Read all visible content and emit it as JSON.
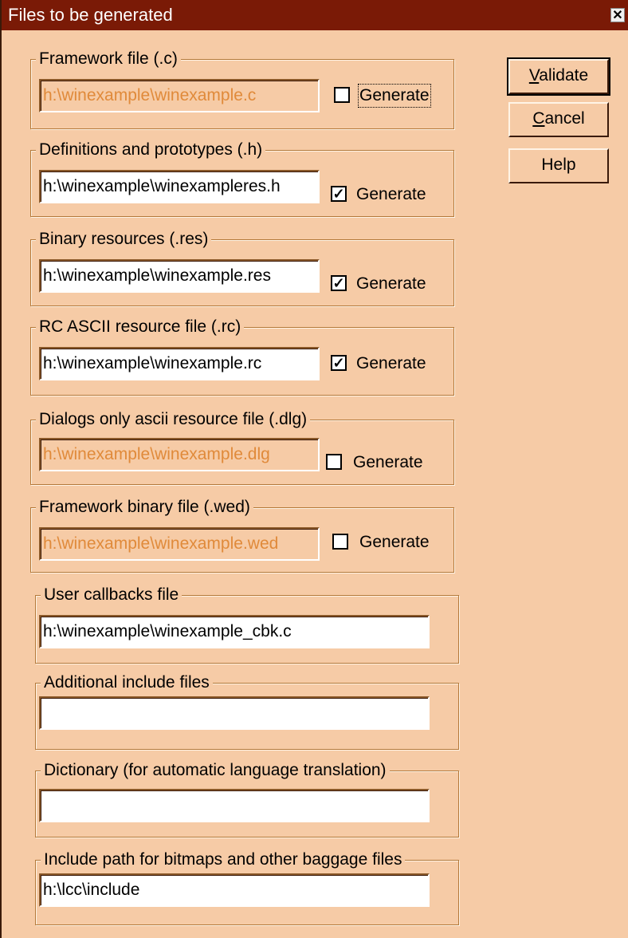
{
  "window": {
    "title": "Files to be generated",
    "close_glyph": "✕"
  },
  "buttons": {
    "validate": {
      "mnemonic": "V",
      "rest": "alidate"
    },
    "cancel": {
      "mnemonic": "C",
      "rest": "ancel"
    },
    "help": {
      "label": "Help"
    }
  },
  "groups": [
    {
      "legend": "Framework file (.c)",
      "value": "h:\\winexample\\winexample.c",
      "enabled": false,
      "checkbox_label": "Generate",
      "checked": false
    },
    {
      "legend": "Definitions and prototypes (.h)",
      "value": "h:\\winexample\\winexampleres.h",
      "enabled": true,
      "checkbox_label": "Generate",
      "checked": true
    },
    {
      "legend": "Binary resources (.res)",
      "value": "h:\\winexample\\winexample.res",
      "enabled": true,
      "checkbox_label": "Generate",
      "checked": true
    },
    {
      "legend": "RC ASCII resource file (.rc)",
      "value": "h:\\winexample\\winexample.rc",
      "enabled": true,
      "checkbox_label": "Generate",
      "checked": true
    },
    {
      "legend": "Dialogs only ascii resource file (.dlg)",
      "value": "h:\\winexample\\winexample.dlg",
      "enabled": false,
      "checkbox_label": "Generate",
      "checked": false
    },
    {
      "legend": "Framework binary file (.wed)",
      "value": "h:\\winexample\\winexample.wed",
      "enabled": false,
      "checkbox_label": "Generate",
      "checked": false
    },
    {
      "legend": "User callbacks file",
      "value": "h:\\winexample\\winexample_cbk.c",
      "enabled": true
    },
    {
      "legend": "Additional include files",
      "value": "",
      "enabled": true
    },
    {
      "legend": "Dictionary (for automatic language translation)",
      "value": "",
      "enabled": true
    },
    {
      "legend": "Include path for bitmaps and other baggage files",
      "value": "h:\\lcc\\include",
      "enabled": true
    }
  ],
  "check_glyph": "✓",
  "colors": {
    "background": "#f6cba6",
    "titlebar": "#7a1a06",
    "disabled_text": "#e08a3a"
  }
}
